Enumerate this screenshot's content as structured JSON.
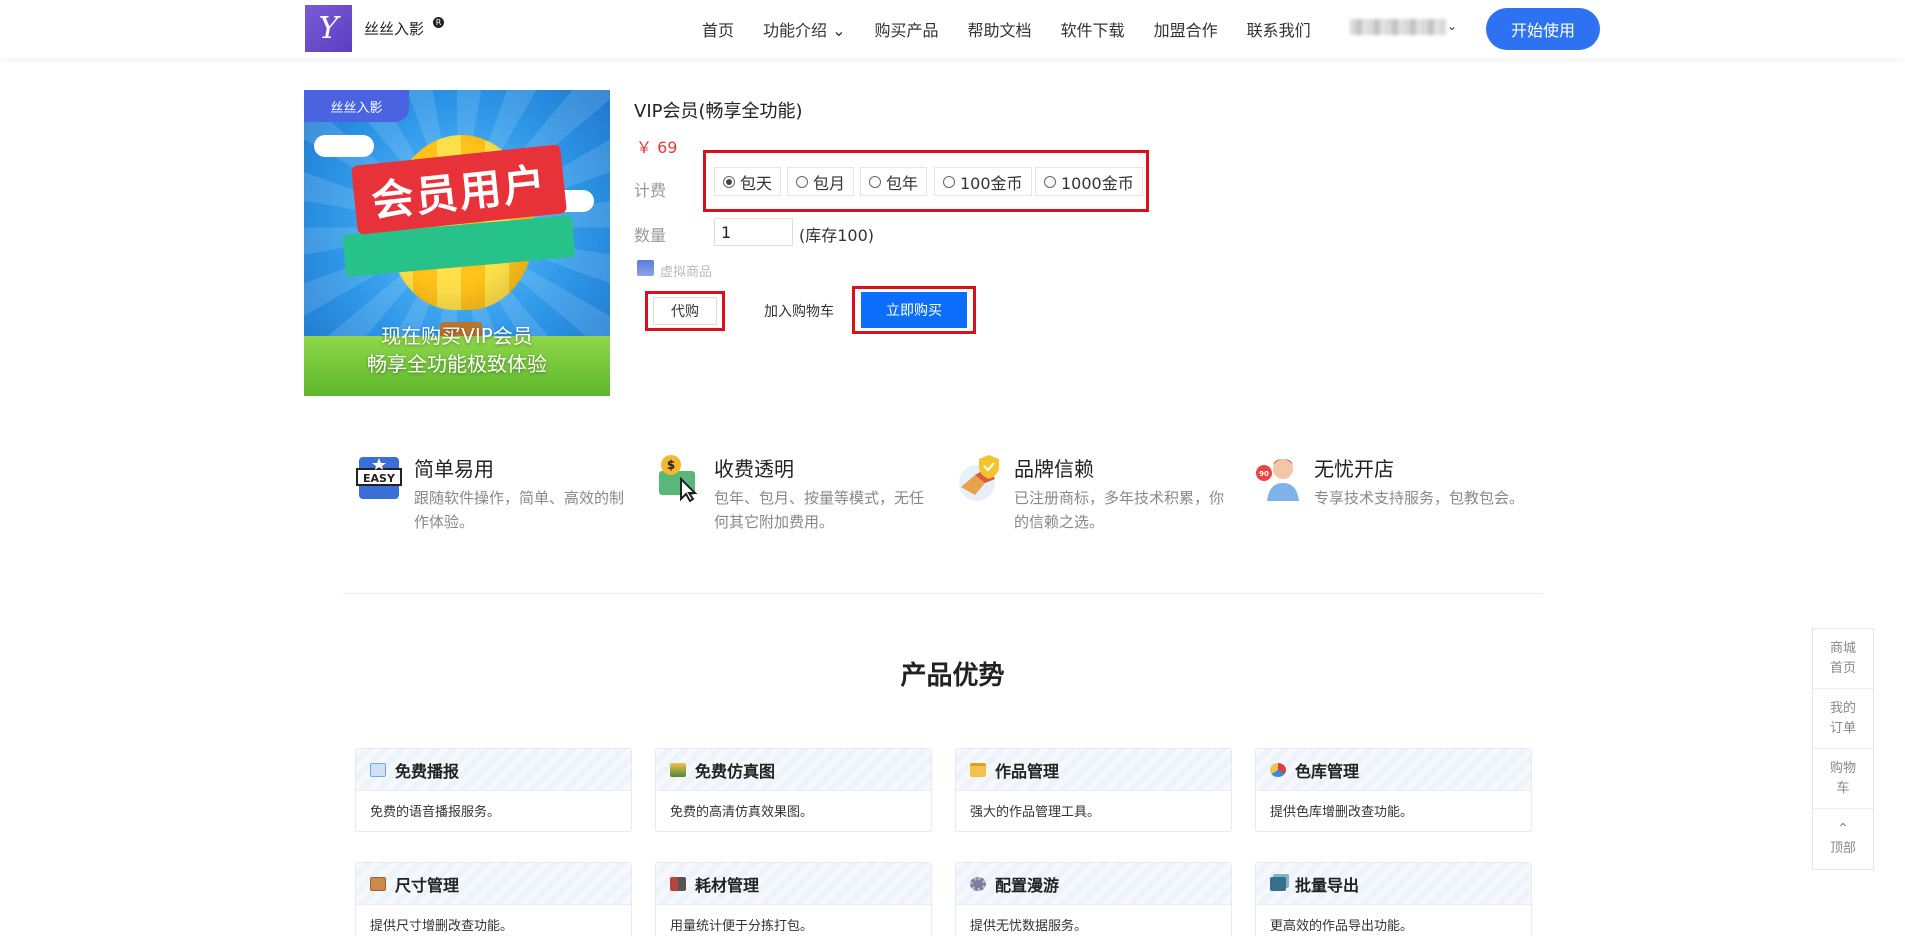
{
  "header": {
    "brand": "丝丝入影",
    "brand_mark": "R",
    "logo_glyph": "Y",
    "nav": [
      {
        "label": "首页"
      },
      {
        "label": "功能介绍 ⌄"
      },
      {
        "label": "购买产品"
      },
      {
        "label": "帮助文档"
      },
      {
        "label": "软件下载"
      },
      {
        "label": "加盟合作"
      },
      {
        "label": "联系我们"
      }
    ],
    "user_chevron": "⌄",
    "start_button": "开始使用"
  },
  "product": {
    "image": {
      "badge": "丝丝入影",
      "headline": "会员用户",
      "line1": "现在购买VIP会员",
      "line2": "畅享全功能极致体验"
    },
    "title": "VIP会员(畅享全功能)",
    "price": "￥ 69",
    "billing_label": "计费",
    "options": [
      {
        "label": "包天",
        "selected": true
      },
      {
        "label": "包月",
        "selected": false
      },
      {
        "label": "包年",
        "selected": false
      },
      {
        "label": "100金币",
        "selected": false
      },
      {
        "label": "1000金币",
        "selected": false
      }
    ],
    "quantity_label": "数量",
    "quantity_value": "1",
    "stock": "(库存100)",
    "virtual_label": "虚拟商品",
    "buttons": {
      "proxy": "代购",
      "add_cart": "加入购物车",
      "buy_now": "立即购买"
    }
  },
  "features": [
    {
      "title": "简单易用",
      "desc": "跟随软件操作，简单、高效的制作体验。",
      "icon": "easy-icon"
    },
    {
      "title": "收费透明",
      "desc": "包年、包月、按量等模式，无任何其它附加费用。",
      "icon": "money-icon"
    },
    {
      "title": "品牌信赖",
      "desc": "已注册商标，多年技术积累，你的信赖之选。",
      "icon": "trust-icon"
    },
    {
      "title": "无忧开店",
      "desc": "专享技术支持服务，包教包会。",
      "icon": "support-icon"
    }
  ],
  "advantages": {
    "title": "产品优势",
    "cards": [
      {
        "title": "免费播报",
        "desc": "免费的语音播报服务。",
        "color": "#6fa8e8"
      },
      {
        "title": "免费仿真图",
        "desc": "免费的高清仿真效果图。",
        "color": "#4c8a3a"
      },
      {
        "title": "作品管理",
        "desc": "强大的作品管理工具。",
        "color": "#e9b43a"
      },
      {
        "title": "色库管理",
        "desc": "提供色库增删改查功能。",
        "color": "#d8413f"
      },
      {
        "title": "尺寸管理",
        "desc": "提供尺寸增删改查功能。",
        "color": "#a8612e"
      },
      {
        "title": "耗材管理",
        "desc": "用量统计便于分拣打包。",
        "color": "#b0463c"
      },
      {
        "title": "配置漫游",
        "desc": "提供无忧数据服务。",
        "color": "#7c7c9c"
      },
      {
        "title": "批量导出",
        "desc": "更高效的作品导出功能。",
        "color": "#3a6f8a"
      }
    ]
  },
  "sidebar": {
    "items": [
      {
        "label": "商城首页"
      },
      {
        "label": "我的订单"
      },
      {
        "label": "购物车"
      },
      {
        "label": "顶部",
        "glyph": "⌃"
      }
    ]
  }
}
